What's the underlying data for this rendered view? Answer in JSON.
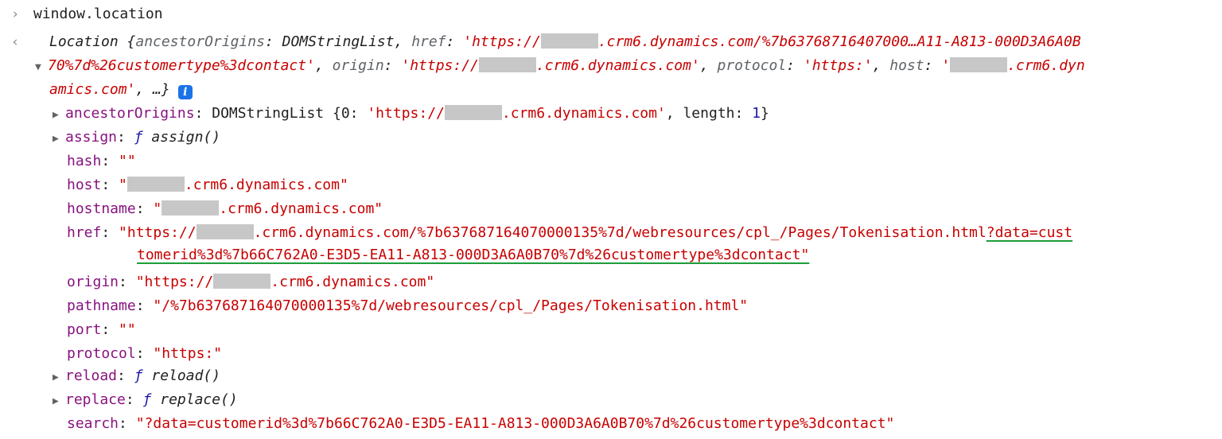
{
  "input": {
    "command": "window.location"
  },
  "summary": {
    "prefix": "Location {",
    "k_ancestor": "ancestorOrigins",
    "v_ancestor": "DOMStringList",
    "k_href": "href",
    "href_open": "'https://",
    "href_rest1": ".crm6.dynamics.com/%7b63768716407000…A11-A813-000D3A6A0B",
    "href_rest2": "70%7d%26customertype%3dcontact'",
    "k_origin": "origin",
    "origin_open": "'https://",
    "origin_rest": ".crm6.dynamics.com'",
    "k_protocol": "protocol",
    "v_protocol": "'https:'",
    "k_host": "host",
    "host_open": "'",
    "host_rest1": ".crm6.dyn",
    "host_rest2": "amics.com'",
    "suffix": ", …}",
    "info_glyph": "i"
  },
  "props": {
    "ancestor": {
      "key": "ancestorOrigins",
      "type": "DOMStringList",
      "open": "{0: ",
      "s_open": "'https://",
      "s_rest": ".crm6.dynamics.com'",
      "len_key": ", length: ",
      "len_val": "1",
      "close": "}"
    },
    "assign": {
      "key": "assign",
      "f": "ƒ",
      "sig": "assign()"
    },
    "hash": {
      "key": "hash",
      "value": "\"\""
    },
    "host": {
      "key": "host",
      "open": "\"",
      "rest": ".crm6.dynamics.com\""
    },
    "hostname": {
      "key": "hostname",
      "open": "\"",
      "rest": ".crm6.dynamics.com\""
    },
    "href": {
      "key": "href",
      "open": "\"https://",
      "rest": ".crm6.dynamics.com/%7b637687164070000135%7d/webresources/cpl_/Pages/Tokenisation.html",
      "hl1": "?data=cust",
      "hl2": "tomerid%3d%7b66C762A0-E3D5-EA11-A813-000D3A6A0B70%7d%26customertype%3dcontact\""
    },
    "origin": {
      "key": "origin",
      "open": "\"https://",
      "rest": ".crm6.dynamics.com\""
    },
    "pathname": {
      "key": "pathname",
      "value": "\"/%7b637687164070000135%7d/webresources/cpl_/Pages/Tokenisation.html\""
    },
    "port": {
      "key": "port",
      "value": "\"\""
    },
    "protocol": {
      "key": "protocol",
      "value": "\"https:\""
    },
    "reload": {
      "key": "reload",
      "f": "ƒ",
      "sig": "reload()"
    },
    "replace": {
      "key": "replace",
      "f": "ƒ",
      "sig": "replace()"
    },
    "search": {
      "key": "search",
      "value": "\"?data=customerid%3d%7b66C762A0-E3D5-EA11-A813-000D3A6A0B70%7d%26customertype%3dcontact\""
    }
  },
  "icons": {
    "prompt": "chevron-right-icon",
    "result": "result-arrow-icon",
    "expand": "triangle-icon"
  },
  "colors": {
    "key": "#881280",
    "string": "#c80000",
    "number": "#1a1aa6",
    "info": "#1a73e8",
    "underline": "#1e9e3a"
  }
}
